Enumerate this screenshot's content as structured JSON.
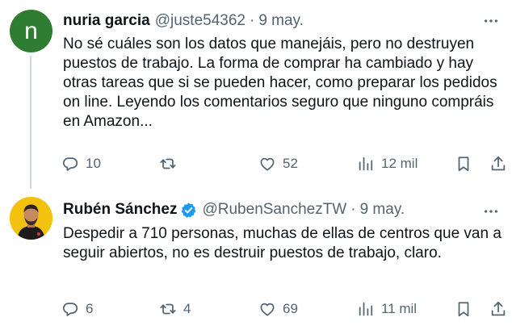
{
  "tweets": [
    {
      "avatar_letter": "n",
      "name": "nuria garcia",
      "handle": "@juste54362",
      "separator": "·",
      "date": "9 may.",
      "text": "No sé cuáles son los datos que manejáis, pero no destruyen puestos de trabajo. La forma de comprar ha cambiado y hay otras tareas que si se pueden hacer, como preparar los pedidos on line. Leyendo los comentarios seguro que ninguno compráis en Amazon...",
      "replies": "10",
      "retweets": "",
      "likes": "52",
      "views": "12 mil"
    },
    {
      "name": "Rubén Sánchez",
      "handle": "@RubenSanchezTW",
      "separator": "·",
      "date": "9 may.",
      "text": "Despedir a 710 personas, muchas de ellas de centros que van a seguir abiertos, no es destruir puestos de trabajo, claro.",
      "replies": "6",
      "retweets": "4",
      "likes": "69",
      "views": "11 mil"
    }
  ],
  "colors": {
    "text_primary": "#0f1419",
    "text_secondary": "#536471",
    "verified_badge": "#1d9bf0",
    "avatar_letter_bg": "#2e7d32",
    "avatar_photo_bg": "#f2c20e",
    "thread_line": "#cfd9de"
  },
  "icons": [
    "more-icon",
    "reply-icon",
    "retweet-icon",
    "like-icon",
    "views-icon",
    "bookmark-icon",
    "share-icon",
    "verified-icon"
  ]
}
